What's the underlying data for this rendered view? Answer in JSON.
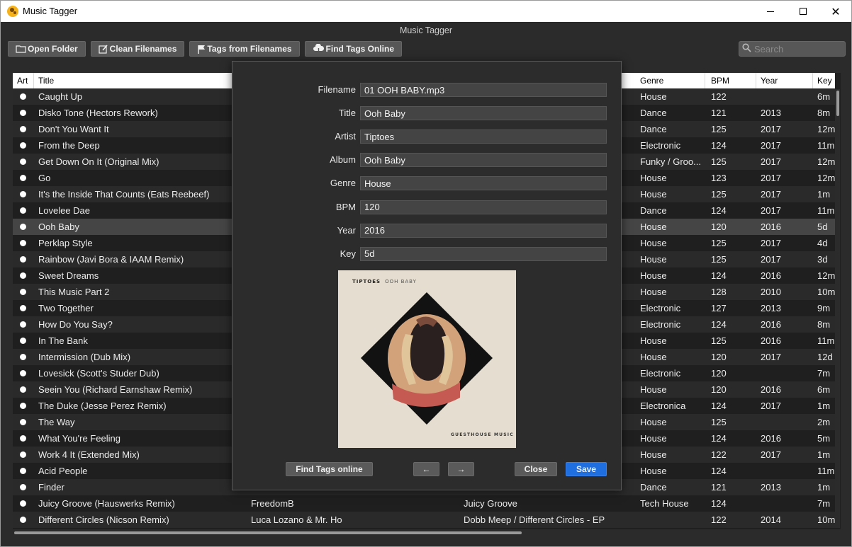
{
  "window": {
    "title": "Music Tagger"
  },
  "app": {
    "header_title": "Music Tagger"
  },
  "toolbar": {
    "open_folder": "Open Folder",
    "clean_filenames": "Clean Filenames",
    "tags_from_filenames": "Tags from Filenames",
    "find_tags_online": "Find Tags Online"
  },
  "search": {
    "placeholder": "Search"
  },
  "table": {
    "columns": {
      "art": "Art",
      "title": "Title",
      "genre": "Genre",
      "bpm": "BPM",
      "year": "Year",
      "key": "Key"
    },
    "rows": [
      {
        "title": "Caught Up",
        "artist": "",
        "album": "",
        "genre": "House",
        "bpm": "122",
        "year": "",
        "key": "6m"
      },
      {
        "title": "Disko Tone (Hectors Rework)",
        "artist": "",
        "album": "",
        "genre": "Dance",
        "bpm": "121",
        "year": "2013",
        "key": "8m"
      },
      {
        "title": "Don't You Want It",
        "artist": "",
        "album": "",
        "genre": "Dance",
        "bpm": "125",
        "year": "2017",
        "key": "12m"
      },
      {
        "title": "From the Deep",
        "artist": "",
        "album": "",
        "genre": "Electronic",
        "bpm": "124",
        "year": "2017",
        "key": "11m"
      },
      {
        "title": "Get Down On It (Original Mix)",
        "artist": "",
        "album": "",
        "genre": "Funky / Groo...",
        "bpm": "125",
        "year": "2017",
        "key": "12m"
      },
      {
        "title": "Go",
        "artist": "",
        "album": "",
        "genre": "House",
        "bpm": "123",
        "year": "2017",
        "key": "12m"
      },
      {
        "title": "It's the Inside That Counts (Eats Reebeef)",
        "artist": "",
        "album": "",
        "genre": "House",
        "bpm": "125",
        "year": "2017",
        "key": "1m"
      },
      {
        "title": "Lovelee Dae",
        "artist": "",
        "album": "",
        "genre": "Dance",
        "bpm": "124",
        "year": "2017",
        "key": "11m"
      },
      {
        "title": "Ooh Baby",
        "artist": "",
        "album": "",
        "genre": "House",
        "bpm": "120",
        "year": "2016",
        "key": "5d"
      },
      {
        "title": "Perklap Style",
        "artist": "",
        "album": "",
        "genre": "House",
        "bpm": "125",
        "year": "2017",
        "key": "4d"
      },
      {
        "title": "Rainbow (Javi Bora & IAAM Remix)",
        "artist": "",
        "album": "",
        "genre": "House",
        "bpm": "125",
        "year": "2017",
        "key": "3d"
      },
      {
        "title": "Sweet Dreams",
        "artist": "",
        "album": "",
        "genre": "House",
        "bpm": "124",
        "year": "2016",
        "key": "12m"
      },
      {
        "title": "This Music Part 2",
        "artist": "",
        "album": "",
        "genre": "House",
        "bpm": "128",
        "year": "2010",
        "key": "10m"
      },
      {
        "title": "Two Together",
        "artist": "",
        "album": "",
        "genre": "Electronic",
        "bpm": "127",
        "year": "2013",
        "key": "9m"
      },
      {
        "title": "How Do You Say?",
        "artist": "",
        "album": "",
        "genre": "Electronic",
        "bpm": "124",
        "year": "2016",
        "key": "8m"
      },
      {
        "title": "In The Bank",
        "artist": "",
        "album": "",
        "genre": "House",
        "bpm": "125",
        "year": "2016",
        "key": "11m"
      },
      {
        "title": "Intermission (Dub Mix)",
        "artist": "",
        "album": "",
        "genre": "House",
        "bpm": "120",
        "year": "2017",
        "key": "12d"
      },
      {
        "title": "Lovesick (Scott's Studer Dub)",
        "artist": "",
        "album": "",
        "genre": "Electronic",
        "bpm": "120",
        "year": "",
        "key": "7m"
      },
      {
        "title": "Seein You (Richard Earnshaw Remix)",
        "artist": "",
        "album": "..",
        "genre": "House",
        "bpm": "120",
        "year": "2016",
        "key": "6m"
      },
      {
        "title": "The Duke (Jesse Perez Remix)",
        "artist": "",
        "album": "",
        "genre": "Electronica",
        "bpm": "124",
        "year": "2017",
        "key": "1m"
      },
      {
        "title": "The Way",
        "artist": "",
        "album": "",
        "genre": "House",
        "bpm": "125",
        "year": "",
        "key": "2m"
      },
      {
        "title": "What You're Feeling",
        "artist": "",
        "album": "",
        "genre": "House",
        "bpm": "124",
        "year": "2016",
        "key": "5m"
      },
      {
        "title": "Work 4 It (Extended Mix)",
        "artist": "",
        "album": "",
        "genre": "House",
        "bpm": "122",
        "year": "2017",
        "key": "1m"
      },
      {
        "title": "Acid People",
        "artist": "",
        "album": "",
        "genre": "House",
        "bpm": "124",
        "year": "",
        "key": "11m"
      },
      {
        "title": "Finder",
        "artist": "",
        "album": "",
        "genre": "Dance",
        "bpm": "121",
        "year": "2013",
        "key": "1m"
      },
      {
        "title": "Juicy Groove (Hauswerks Remix)",
        "artist": "FreedomB",
        "album": "Juicy Groove",
        "genre": "Tech House",
        "bpm": "124",
        "year": "",
        "key": "7m"
      },
      {
        "title": "Different Circles (Nicson Remix)",
        "artist": "Luca Lozano & Mr. Ho",
        "album": "Dobb Meep / Different Circles - EP",
        "genre": "",
        "bpm": "122",
        "year": "2014",
        "key": "10m"
      }
    ],
    "selected_index": 8
  },
  "editor": {
    "fields": [
      {
        "label": "Filename",
        "value": "01 OOH BABY.mp3"
      },
      {
        "label": "Title",
        "value": "Ooh Baby"
      },
      {
        "label": "Artist",
        "value": "Tiptoes"
      },
      {
        "label": "Album",
        "value": "Ooh Baby"
      },
      {
        "label": "Genre",
        "value": "House"
      },
      {
        "label": "BPM",
        "value": "120"
      },
      {
        "label": "Year",
        "value": "2016"
      },
      {
        "label": "Key",
        "value": "5d"
      }
    ],
    "artwork": {
      "artist_text": "TIPTOES",
      "title_text": "OOH BABY",
      "label_text": "GUESTHOUSE MUSIC"
    },
    "buttons": {
      "find_tags_online": "Find Tags online",
      "prev": "←",
      "next": "→",
      "close": "Close",
      "save": "Save"
    }
  },
  "colors": {
    "accent": "#1f6fe0",
    "background": "#2b2b2b",
    "row_alt": "#2a2a2a",
    "row_selected": "#454545"
  }
}
